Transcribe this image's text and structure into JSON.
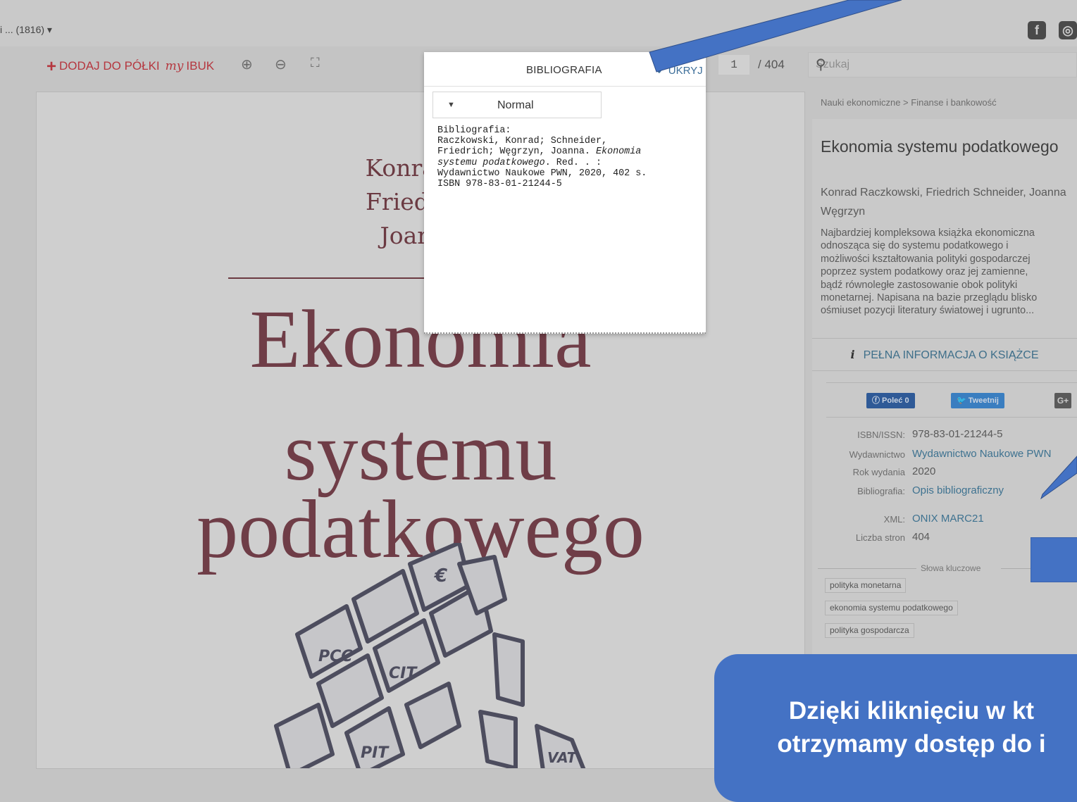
{
  "topbar": {
    "selector_text": "i ... (1816) ▾",
    "social": [
      {
        "name": "facebook-icon",
        "glyph": "f"
      },
      {
        "name": "instagram-icon",
        "glyph": "◎"
      }
    ]
  },
  "toolbar": {
    "add_to_shelf": "DODAJ DO PÓŁKI",
    "my_prefix": "my",
    "ibuk": "IBUK",
    "zoom_in_glyph": "⊕",
    "zoom_out_glyph": "⊖",
    "fullscreen_glyph": "⛶",
    "page_current": "1",
    "page_total": "/ 404",
    "search_placeholder": "Szukaj",
    "search_glyph": "⚲"
  },
  "cover": {
    "authors": [
      "Konrad R",
      "Friedrich",
      "Joanna"
    ],
    "title_lines": [
      "Ekonomia",
      "systemu",
      "podatkowego"
    ],
    "cube_labels": [
      "PCC",
      "CIT",
      "PIT",
      "VAT",
      "€"
    ]
  },
  "popup": {
    "title": "BIBLIOGRAFIA",
    "hide": "✔ UKRYJ",
    "style_arrow": "▼",
    "style_value": "Normal",
    "label": "Bibliografia:",
    "line1": "Raczkowski, Konrad; Schneider,",
    "line2_a": "Friedrich; Węgrzyn, Joanna. ",
    "line2_b": "Ekonomia",
    "line3_a": "systemu podatkowego",
    "line3_b": ". Red. . :",
    "line4": "Wydawnictwo Naukowe PWN, 2020, 402 s.",
    "line5": "ISBN 978-83-01-21244-5"
  },
  "sidebar": {
    "breadcrumb": "Nauki ekonomiczne > Finanse i bankowość",
    "title": "Ekonomia systemu podatkowego",
    "authors": "Konrad Raczkowski, Friedrich Schneider, Joanna Węgrzyn",
    "description": "Najbardziej kompleksowa książka ekonomiczna\nodnosząca się do systemu podatkowego i\nmożliwości kształtowania polityki gospodarczej\npoprzez system podatkowy oraz jej zamienne,\nbądź równoległe zastosowanie obok polityki\nmonetarnej. Napisana na bazie przeglądu blisko\nośmiuset pozycji literatury światowej i ugrunto...",
    "full_info": "PEŁNA INFORMACJA O KSIĄŻCE",
    "info_glyph": "i",
    "share": {
      "like": "ⓕ Poleć 0",
      "tweet": "🐦 Tweetnij",
      "gplus": "G+"
    },
    "meta": [
      {
        "label": "ISBN/ISSN:",
        "value": "978-83-01-21244-5",
        "link": false
      },
      {
        "label": "Wydawnictwo",
        "value": "Wydawnictwo Naukowe PWN",
        "link": true
      },
      {
        "label": "Rok wydania",
        "value": "2020",
        "link": false
      },
      {
        "label": "Bibliografia:",
        "value": "Opis bibliograficzny",
        "link": true
      },
      {
        "label": "XML:",
        "value": "ONIX MARC21",
        "link": true
      },
      {
        "label": "Liczba stron",
        "value": "404",
        "link": false
      }
    ],
    "keywords_legend": "Słowa kluczowe",
    "keywords": [
      "polityka monetarna",
      "ekonomia systemu podatkowego",
      "polityka gospodarcza"
    ]
  },
  "annotation": {
    "line1": "Dzięki kliknięciu w kt",
    "line2": "otrzymamy dostęp do i"
  },
  "colors": {
    "accent_red": "#b5373f",
    "link_blue": "#3e7290",
    "callout_blue": "#4472c4",
    "cover_wine": "#6f3d47"
  }
}
